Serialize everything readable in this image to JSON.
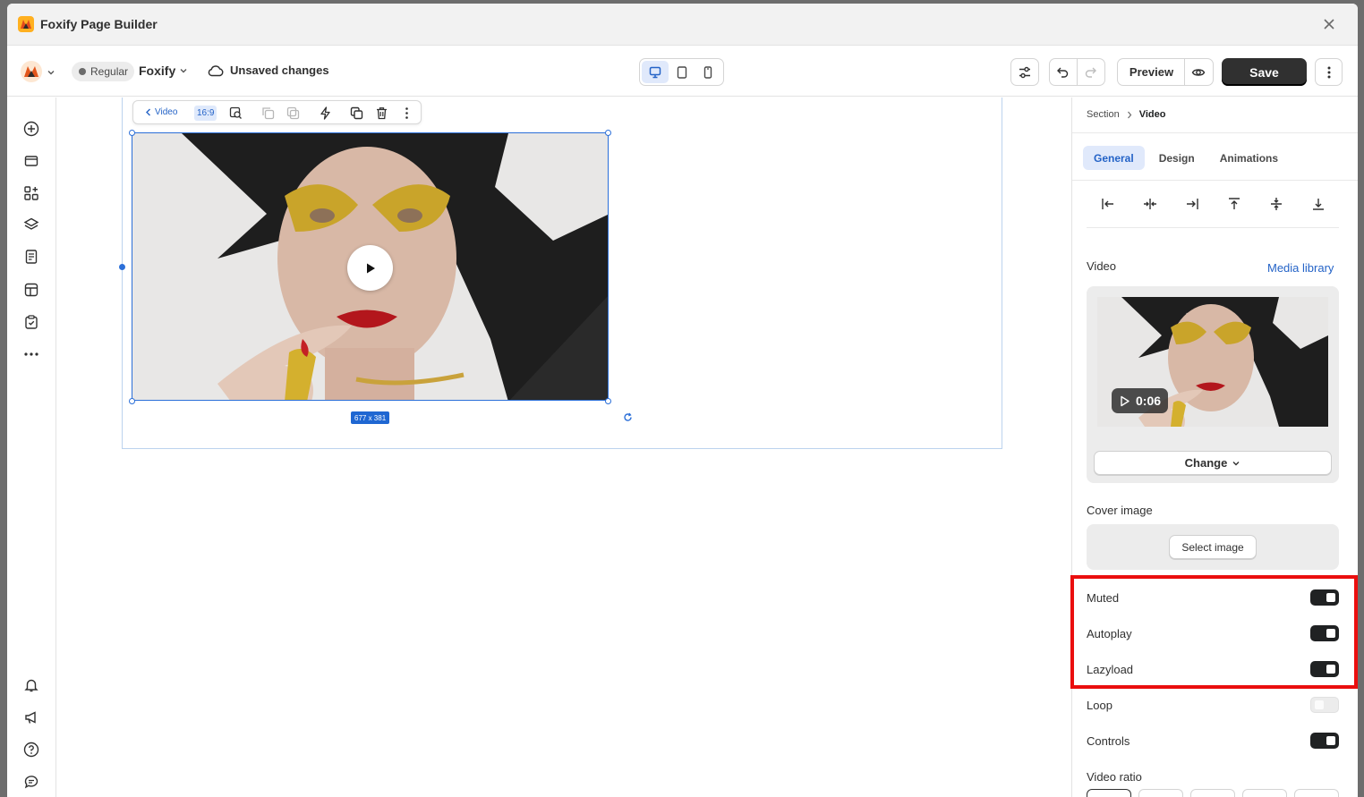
{
  "window": {
    "title": "Foxify Page Builder"
  },
  "toolbar": {
    "theme_badge": "Regular",
    "store_name": "Foxify",
    "save_status": "Unsaved changes",
    "preview_label": "Preview",
    "save_label": "Save"
  },
  "canvas": {
    "element_toolbar": {
      "back_label": "Video",
      "ratio_label": "16:9"
    },
    "size_tag": "677 x 381"
  },
  "panel": {
    "breadcrumb": {
      "parent": "Section",
      "current": "Video"
    },
    "tabs": [
      {
        "label": "General",
        "active": true
      },
      {
        "label": "Design",
        "active": false
      },
      {
        "label": "Animations",
        "active": false
      }
    ],
    "video": {
      "label": "Video",
      "media_library_link": "Media library",
      "duration": "0:06",
      "change_label": "Change"
    },
    "cover_image": {
      "label": "Cover image",
      "select_label": "Select image"
    },
    "toggles": [
      {
        "label": "Muted",
        "on": true
      },
      {
        "label": "Autoplay",
        "on": true
      },
      {
        "label": "Lazyload",
        "on": true
      },
      {
        "label": "Loop",
        "on": false
      },
      {
        "label": "Controls",
        "on": true
      }
    ],
    "video_ratio_label": "Video ratio"
  },
  "colors": {
    "accent": "#2463c7",
    "save_bg": "#303030",
    "highlight": "#ea0e0e"
  }
}
